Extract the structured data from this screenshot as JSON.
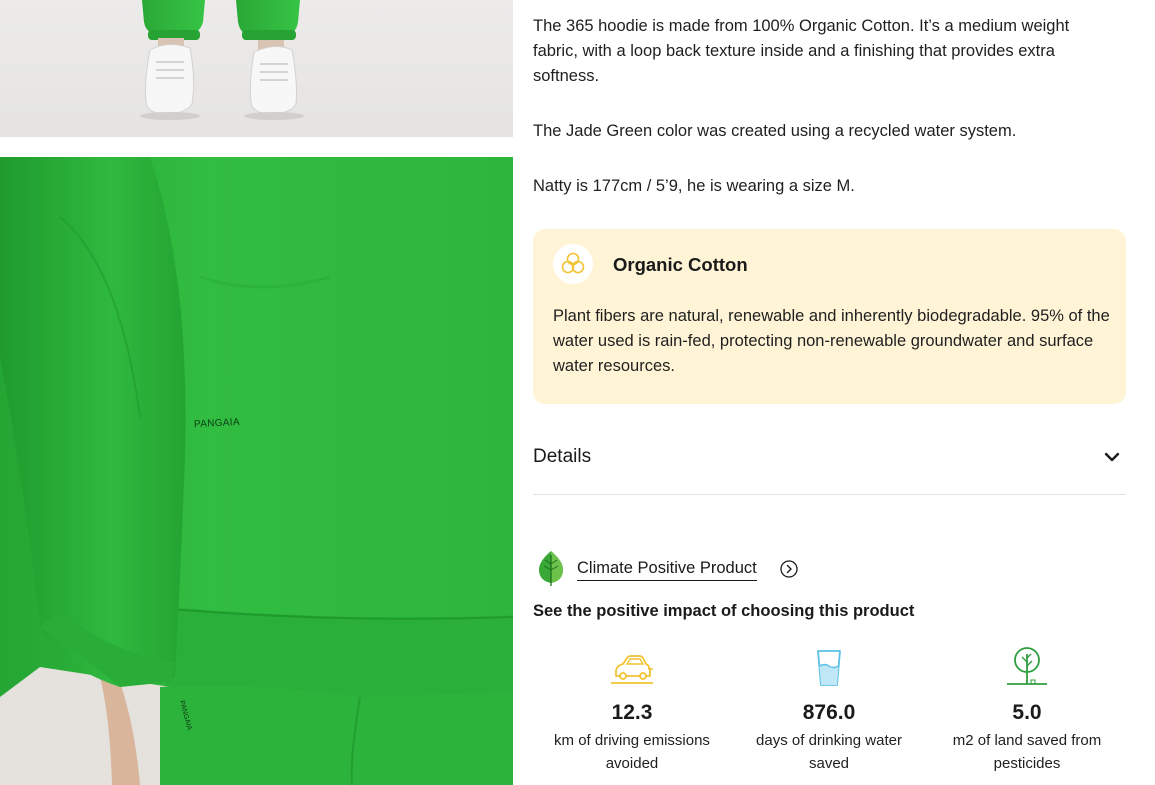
{
  "description": {
    "paragraph_1": "The 365 hoodie is made from 100% Organic Cotton. It’s a medium weight fabric, with a loop back texture inside and a finishing that provides extra softness.",
    "paragraph_2": "The Jade Green color was created using a recycled water system.",
    "paragraph_3": "Natty is 177cm / 5’9, he is wearing a size M."
  },
  "material_card": {
    "icon": "cotton-flower-icon",
    "title": "Organic Cotton",
    "text": "Plant fibers are natural, renewable and inherently biodegradable. 95% of the water used is rain-fed, protecting non-renewable groundwater and surface water resources.",
    "background_color": "#fff4d6"
  },
  "details": {
    "label": "Details",
    "icon": "chevron-down-icon"
  },
  "climate": {
    "icon": "leaf-icon",
    "link_label": "Climate Positive Product",
    "arrow_icon": "arrow-right-circle-icon",
    "heading": "See the positive impact of choosing this product"
  },
  "impact_stats": [
    {
      "icon": "car-icon",
      "value": "12.3",
      "label": "km of driving emissions avoided",
      "color": "#f1c232"
    },
    {
      "icon": "water-glass-icon",
      "value": "876.0",
      "label": "days of drinking water saved",
      "color": "#5bc0e8"
    },
    {
      "icon": "tree-icon",
      "value": "5.0",
      "label": "m2 of land saved from pesticides",
      "color": "#2e9e3e"
    }
  ],
  "product_images": {
    "brand_print": "PANGAIA",
    "brand_print_pants": "PANGAIA",
    "garment_color": "#2bb33c"
  }
}
